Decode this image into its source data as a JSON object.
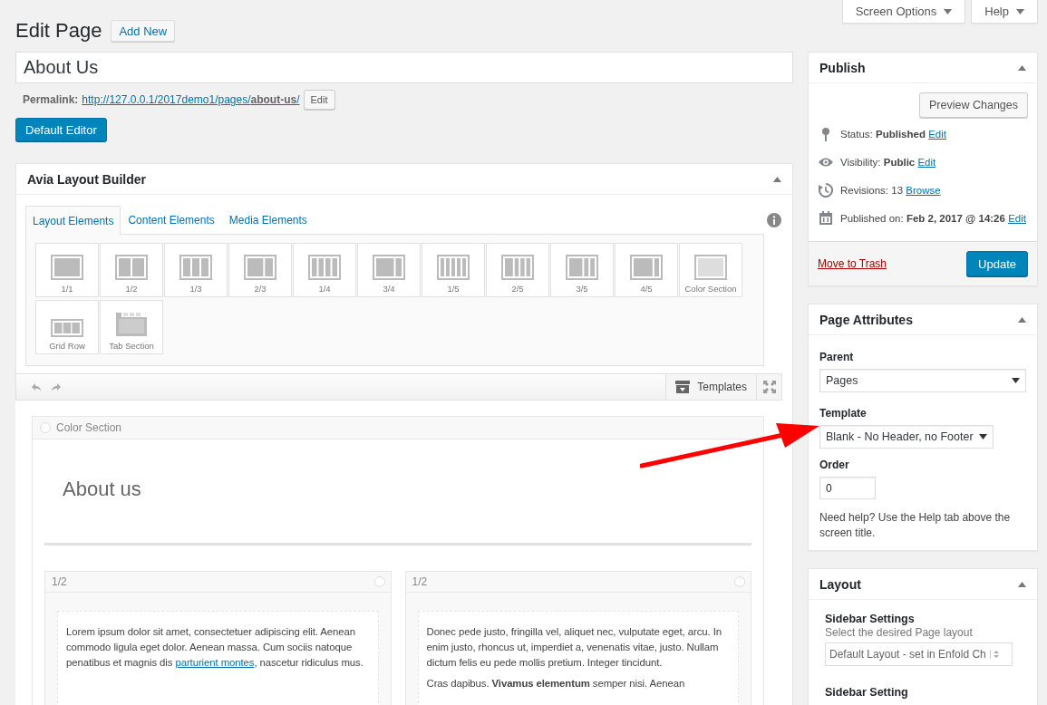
{
  "screen_tabs": [
    {
      "label": "Screen Options"
    },
    {
      "label": "Help"
    }
  ],
  "heading": "Edit Page",
  "add_new": "Add New",
  "title_field": {
    "value": "About Us"
  },
  "permalink": {
    "label": "Permalink:",
    "url": "http://127.0.0.1/2017demo1/pages/**about-us**/",
    "edit": "Edit"
  },
  "default_editor": "Default Editor",
  "builder": {
    "title": "Avia Layout Builder",
    "tabs": [
      {
        "label": "Layout Elements",
        "selected": true
      },
      {
        "label": "Content Elements",
        "selected": false
      },
      {
        "label": "Media Elements",
        "selected": false
      }
    ],
    "elements": [
      {
        "label": "1/1",
        "kind": "one"
      },
      {
        "label": "1/2",
        "kind": "half"
      },
      {
        "label": "1/3",
        "kind": "third"
      },
      {
        "label": "2/3",
        "kind": "two-thirds"
      },
      {
        "label": "1/4",
        "kind": "quarter"
      },
      {
        "label": "3/4",
        "kind": "three-quarters"
      },
      {
        "label": "1/5",
        "kind": "fifth"
      },
      {
        "label": "2/5",
        "kind": "two-fifths"
      },
      {
        "label": "3/5",
        "kind": "three-fifths"
      },
      {
        "label": "4/5",
        "kind": "four-fifths"
      },
      {
        "label": "Color Section",
        "kind": "color-section"
      },
      {
        "label": "Grid Row",
        "kind": "grid-row"
      },
      {
        "label": "Tab Section",
        "kind": "tab-section"
      }
    ],
    "templates": "Templates",
    "canvas": {
      "section_label": "Color Section",
      "heading": "About us",
      "columns": [
        {
          "label": "1/2",
          "paragraphs": [
            [
              {
                "text": "Lorem ipsum dolor sit amet, consectetuer adipiscing elit. Aenean commodo ligula eget dolor. Aenean massa. Cum sociis natoque penatibus et magnis dis "
              },
              {
                "link": "parturient montes"
              },
              {
                "text": ", nascetur ridiculus mus."
              }
            ]
          ]
        },
        {
          "label": "1/2",
          "paragraphs": [
            [
              {
                "text": "Donec pede justo, fringilla vel, aliquet nec, vulputate eget, arcu. In enim justo, rhoncus ut, imperdiet a, venenatis vitae, justo. Nullam dictum felis eu pede mollis pretium. Integer tincidunt."
              }
            ],
            [
              {
                "text": "Cras dapibus. **Vivamus elementum** semper nisi. Aenean"
              }
            ]
          ]
        }
      ]
    }
  },
  "publish": {
    "title": "Publish",
    "preview": "Preview Changes",
    "rows": [
      {
        "kind": "status",
        "text": "Status: **Published**",
        "link": "Edit"
      },
      {
        "kind": "visibility",
        "text": "Visibility: **Public**",
        "link": "Edit"
      },
      {
        "kind": "revisions",
        "text": "Revisions: 13",
        "link": "Browse"
      },
      {
        "kind": "date",
        "text": "Published on: **Feb 2, 2017 @ 14:26**",
        "link": "Edit"
      }
    ],
    "trash": "Move to Trash",
    "update": "Update"
  },
  "attributes": {
    "title": "Page Attributes",
    "parent_label": "Parent",
    "parent": "Pages",
    "template_label": "Template",
    "template": "Blank - No Header, no Footer",
    "order_label": "Order",
    "order": "0",
    "help": "Need help? Use the Help tab above the screen title."
  },
  "layout": {
    "title": "Layout",
    "setting_title": "Sidebar Settings",
    "setting_desc": "Select the desired Page layout",
    "setting_value": "Default Layout - set in Enfold Ch",
    "next_title": "Sidebar Setting"
  }
}
